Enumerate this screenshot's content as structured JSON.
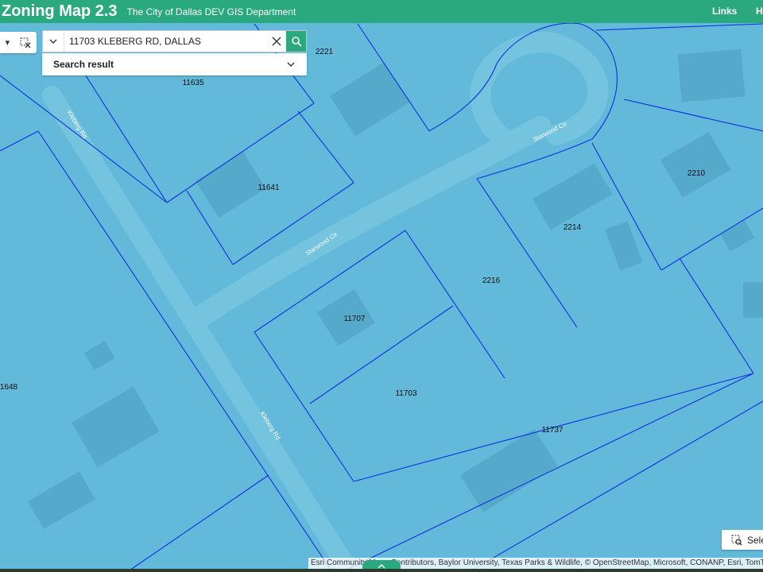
{
  "header": {
    "title": "Zoning Map 2.3",
    "subtitle": "The City of Dallas DEV GIS Department",
    "links_label": "Links",
    "h_label": "H"
  },
  "search": {
    "value": "11703 KLEBERG RD, DALLAS",
    "result_label": "Search result"
  },
  "map": {
    "streets": [
      "Kleberg Rd",
      "Kleberg Rd",
      "Starwood Cir",
      "Starwood Cir"
    ],
    "parcels": [
      "2221",
      "11635",
      "11641",
      "2210",
      "2214",
      "2216",
      "11707",
      "11703",
      "11737",
      "1648"
    ]
  },
  "select_label": "Sele",
  "attribution": "Esri Community Maps Contributors, Baylor University, Texas Parks & Wildlife, © OpenStreetMap, Microsoft, CONANP, Esri, TomTom",
  "colors": {
    "header": "#2aa87e",
    "map_fill": "#62b9d9",
    "road": "#74c4e0",
    "parcel_line": "#1030e0"
  }
}
